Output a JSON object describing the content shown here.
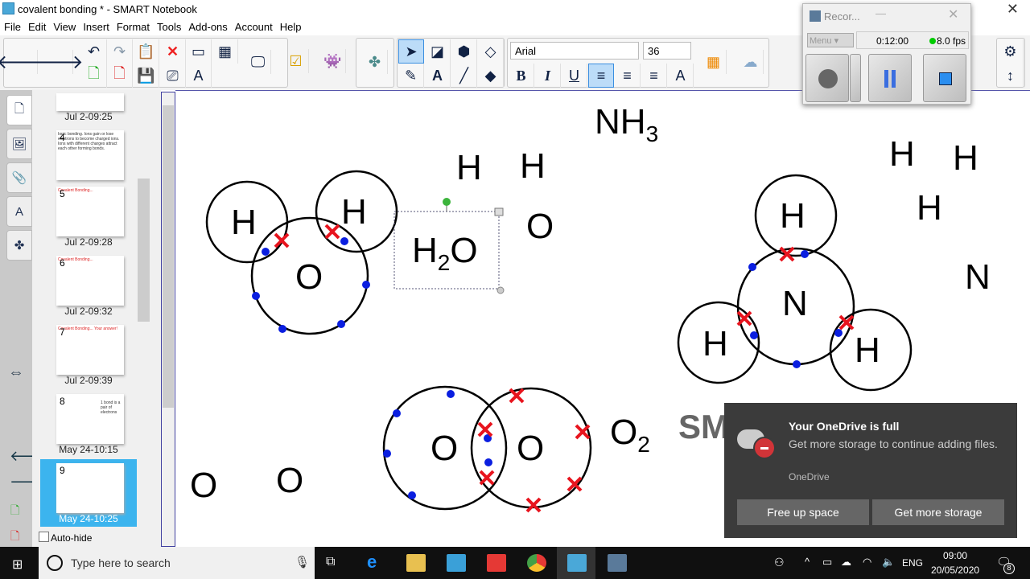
{
  "window": {
    "title": "covalent bonding * - SMART Notebook"
  },
  "menu": [
    "File",
    "Edit",
    "View",
    "Insert",
    "Format",
    "Tools",
    "Add-ons",
    "Account",
    "Help"
  ],
  "toolbar": {
    "font": "Arial",
    "size": "36",
    "bold": "B",
    "italic": "I",
    "underline": "U"
  },
  "sorter": {
    "thumbs": [
      {
        "num": "",
        "label": "Jul 2-09:25",
        "text": ""
      },
      {
        "num": "4",
        "label": "",
        "text": "Ionic bonding. Ions gain or lose electrons to become charged ions. Ions with different charges attract each other forming bonds."
      },
      {
        "num": "5",
        "label": "Jul 2-09:28",
        "text": "Covalent Bonding..."
      },
      {
        "num": "6",
        "label": "Jul 2-09:32",
        "text": "Covalent Bonding..."
      },
      {
        "num": "7",
        "label": "Jul 2-09:39",
        "text": "Covalent Bonding... Your answer!"
      },
      {
        "num": "8",
        "label": "May 24-10:15",
        "text": "1 bond is a pair of electrons"
      },
      {
        "num": "9",
        "label": "May 24-10:25",
        "text": ""
      }
    ],
    "autohide": "Auto-hide"
  },
  "canvas": {
    "labels": {
      "h1": "H",
      "h2": "H",
      "o1": "O",
      "nh3": "NH",
      "nh3_sub": "3",
      "h2o": "H",
      "h2o_sub": "2",
      "h2o_o": "O",
      "free_h1": "H",
      "free_h2": "H",
      "free_o": "O",
      "rh1": "H",
      "rh2": "H",
      "rh3": "H",
      "rn": "N",
      "nh_top": "H",
      "nh_n": "N",
      "nh_left": "H",
      "nh_right": "H",
      "o2a": "O",
      "o2b": "O",
      "o2": "O",
      "o2_sub": "2",
      "lo1": "O",
      "lo2": "O",
      "sm": "SM"
    },
    "colors": {
      "electron_dot": "#0a1ee0",
      "electron_cross": "#e8141e",
      "selection_handle": "#3cb43c"
    }
  },
  "recorder": {
    "title": "Recor...",
    "menu": "Menu",
    "time": "0:12:00",
    "fps": "8.0 fps",
    "fps_color": "#00cc00"
  },
  "toast": {
    "title": "Your OneDrive is full",
    "body": "Get more storage to continue adding files.",
    "source": "OneDrive",
    "btn1": "Free up space",
    "btn2": "Get more storage"
  },
  "taskbar": {
    "search_placeholder": "Type here to search",
    "lang": "ENG",
    "time": "09:00",
    "date": "20/05/2020",
    "notifications": "8"
  }
}
